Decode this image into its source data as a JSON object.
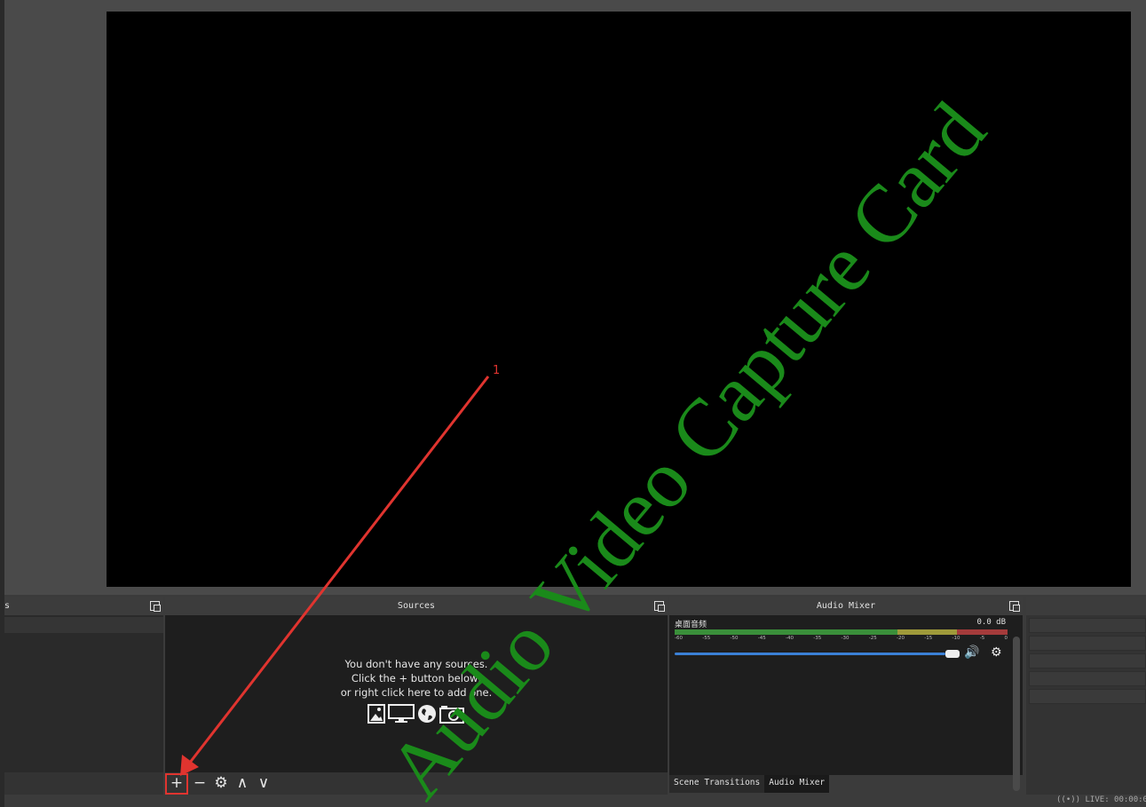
{
  "sources": {
    "title": "Sources",
    "empty_line1": "You don't have any sources.",
    "empty_line2": "Click the + button below,",
    "empty_line3": "or right click here to add one.",
    "toolbar": {
      "add": "+",
      "remove": "−",
      "settings": "⚙",
      "up": "∧",
      "down": "∨"
    }
  },
  "scenes": {
    "title_fragment": "s"
  },
  "mixer": {
    "title": "Audio Mixer",
    "channel_name": "桌面音频",
    "channel_db": "0.0 dB",
    "ticks": [
      "-60",
      "-55",
      "-50",
      "-45",
      "-40",
      "-35",
      "-30",
      "-25",
      "-20",
      "-15",
      "-10",
      "-5",
      "0"
    ],
    "speaker_icon": "🔊",
    "gear_icon": "⚙"
  },
  "mixer_tabs": [
    "Scene Transitions",
    "Audio Mixer"
  ],
  "status": {
    "live": "LIVE: 00:00:0"
  },
  "annotation": {
    "number": "1",
    "color": "#e0342f"
  },
  "watermark": {
    "text": "Audio Video Capture Card",
    "color": "#1a8a1a"
  }
}
